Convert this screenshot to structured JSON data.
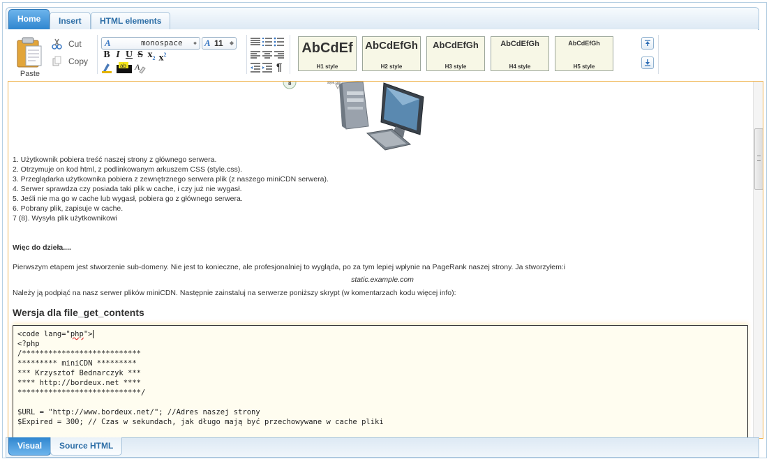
{
  "tabs": [
    {
      "label": "Home",
      "active": true
    },
    {
      "label": "Insert",
      "active": false
    },
    {
      "label": "HTML elements",
      "active": false
    }
  ],
  "clipboard": {
    "paste": "Paste",
    "cut": "Cut",
    "copy": "Copy"
  },
  "font": {
    "family": "monospace",
    "size": "11"
  },
  "styles": [
    {
      "sample": "AbCdEf",
      "caption": "H1 style"
    },
    {
      "sample": "AbCdEfGh",
      "caption": "H2 style"
    },
    {
      "sample": "AbCdEfGh",
      "caption": "H3 style"
    },
    {
      "sample": "AbCdEfGh",
      "caption": "H4 style"
    },
    {
      "sample": "AbCdEfGh",
      "caption": "H5 style"
    }
  ],
  "diagram": {
    "badge": "8",
    "caption": "style.css"
  },
  "content": {
    "steps": [
      "1. Użytkownik pobiera treść naszej strony z głównego serwera.",
      "2. Otrzymuje on kod html, z podlinkowanym arkuszem CSS (style.css).",
      "3. Przeglądarka użytkownika pobiera z zewnętrznego serwera plik (z naszego miniCDN serwera).",
      "4. Serwer sprawdza czy posiada taki plik w cache, i czy już nie wygasł.",
      "5. Jeśli nie ma go w cache lub wygasł, pobiera go z głównego serwera.",
      "6. Pobrany plik, zapisuje w cache.",
      "7 (8). Wysyła plik użytkownikowi"
    ],
    "heading_bold": "Więc do dzieła....",
    "para1": "Pierwszym etapem jest stworzenie sub-domeny. Nie jest to konieczne, ale profesjonalniej to wygląda, po za tym lepiej wpłynie na PageRank naszej strony. Ja stworzyłem:i",
    "domain": "static.example.com",
    "para2": "Należy ją podpiąć na nasz serwer plików miniCDN. Następnie zainstaluj na serwerze poniższy skrypt (w komentarzach kodu więcej info):",
    "h3": "Wersja dla file_get_contents",
    "code": {
      "line1_a": "<code lang=\"",
      "line1_b": "php",
      "line1_c": "\">",
      "lines": [
        "<?php",
        "/***************************",
        "********* miniCDN *********",
        "*** Krzysztof Bednarczyk ***",
        "**** http://bordeux.net ****",
        "****************************/",
        "",
        "$URL = \"http://www.bordeux.net/\"; //Adres naszej strony",
        "$Expired = 300; // Czas w sekundach, jak długo mają być przechowywane w cache pliki"
      ]
    }
  },
  "bottom_tabs": [
    {
      "label": "Visual",
      "active": true
    },
    {
      "label": "Source HTML",
      "active": false
    }
  ]
}
